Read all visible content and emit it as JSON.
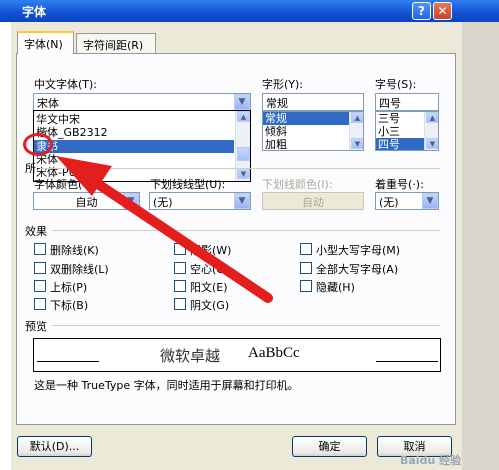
{
  "window": {
    "title": "字体",
    "help_glyph": "?",
    "close_glyph": "✕"
  },
  "tabs": [
    {
      "label": "字体(N)"
    },
    {
      "label": "字符间距(R)"
    }
  ],
  "chinese_font": {
    "label": "中文字体(T):",
    "value": "宋体",
    "dropdown_items": [
      "华文中宋",
      "楷体_GB2312",
      "隶书",
      "宋体",
      "宋体-PUA"
    ],
    "selected_item": "隶书"
  },
  "style": {
    "label": "字形(Y):",
    "value": "常规",
    "items": [
      "常规",
      "倾斜",
      "加粗"
    ]
  },
  "size": {
    "label": "字号(S):",
    "value": "四号",
    "items": [
      "三号",
      "小三",
      "四号"
    ]
  },
  "western_label_fragment": "所",
  "font_color": {
    "label": "字体颜色(C):",
    "value": "自动"
  },
  "underline_style": {
    "label": "下划线线型(U):",
    "value": "(无)"
  },
  "underline_color": {
    "label": "下划线颜色(I):",
    "value": "自动"
  },
  "emphasis": {
    "label": "着重号(·):",
    "value": "(无)"
  },
  "effects": {
    "title": "效果",
    "col1": [
      "删除线(K)",
      "双删除线(L)",
      "上标(P)",
      "下标(B)"
    ],
    "col2": [
      "阴影(W)",
      "空心(O)",
      "阳文(E)",
      "阴文(G)"
    ],
    "col3": [
      "小型大写字母(M)",
      "全部大写字母(A)",
      "隐藏(H)"
    ]
  },
  "preview": {
    "title": "预览",
    "sample_chinese": "微软卓越",
    "sample_latin": "AaBbCc",
    "note": "这是一种 TrueType 字体，同时适用于屏幕和打印机。"
  },
  "buttons": {
    "default": "默认(D)...",
    "ok": "确定",
    "cancel": "取消"
  },
  "watermark": "Baidu 经验",
  "annotation_color": "#e41d1d"
}
